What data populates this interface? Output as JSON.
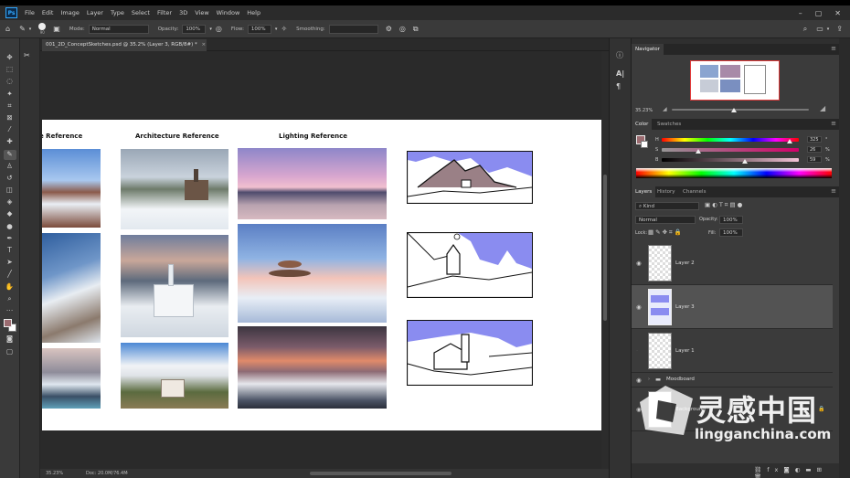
{
  "menubar": {
    "logo": "Ps",
    "items": [
      "File",
      "Edit",
      "Image",
      "Layer",
      "Type",
      "Select",
      "Filter",
      "3D",
      "View",
      "Window",
      "Help"
    ],
    "window_controls": [
      "–",
      "▢",
      "✕"
    ]
  },
  "options_bar": {
    "brush_size": "90",
    "mode_label": "Mode:",
    "mode_value": "Normal",
    "opacity_label": "Opacity:",
    "opacity_value": "100%",
    "flow_label": "Flow:",
    "flow_value": "100%",
    "smoothing_label": "Smoothing:",
    "smoothing_value": ""
  },
  "document": {
    "tab_title": "001_2D_ConceptSketches.psd @ 35.2% (Layer 3, RGB/8#) *"
  },
  "canvas": {
    "columns": [
      {
        "title": "e Reference"
      },
      {
        "title": "Architecture Reference"
      },
      {
        "title": "Lighting Reference"
      }
    ]
  },
  "status": {
    "zoom": "35.23%",
    "doc_size": "Doc: 20.0M/76.4M"
  },
  "navigator": {
    "title": "Navigator",
    "zoom": "35.23%"
  },
  "color_panel": {
    "tabs": [
      "Color",
      "Swatches"
    ],
    "channels": [
      {
        "label": "H",
        "value": "325",
        "unit": "°"
      },
      {
        "label": "S",
        "value": "26",
        "unit": "%"
      },
      {
        "label": "B",
        "value": "59",
        "unit": "%"
      }
    ],
    "colors": {
      "foreground": "#9b6b70",
      "accent": "#31a8ff"
    }
  },
  "layers_panel": {
    "tabs": [
      "Layers",
      "History",
      "Channels"
    ],
    "kind_label": "Kind",
    "blend_mode": "Normal",
    "opacity_label": "Opacity:",
    "opacity_value": "100%",
    "lock_label": "Lock:",
    "fill_label": "Fill:",
    "fill_value": "100%",
    "layers": [
      {
        "name": "Layer 2",
        "visible": true,
        "selected": false
      },
      {
        "name": "Layer 3",
        "visible": true,
        "selected": true
      },
      {
        "name": "Layer 1",
        "visible": false,
        "selected": false
      },
      {
        "name": "Moodboard",
        "visible": true,
        "group": true
      },
      {
        "name": "Background",
        "visible": true,
        "locked": true
      }
    ]
  },
  "watermark": {
    "cn": "灵感中国",
    "en": "lingganchina.com"
  }
}
